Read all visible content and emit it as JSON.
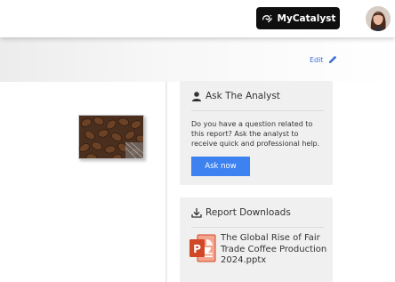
{
  "header": {
    "brand_button_label": "MyCatalyst",
    "brand_icon": "catalyst-swirl-icon",
    "avatar_icon": "user-avatar"
  },
  "toolbar": {
    "edit_label": "Edit",
    "edit_icon": "pencil-icon"
  },
  "report": {
    "thumbnail_icon": "coffee-beans-image"
  },
  "ask_analyst": {
    "title": "Ask The Analyst",
    "icon": "person-icon",
    "description": "Do you have a question related to this report? Ask the analyst to receive quick and professional help.",
    "button_label": "Ask now"
  },
  "downloads": {
    "title": "Report Downloads",
    "icon": "download-icon",
    "file_icon": "powerpoint-icon",
    "file_name": "The Global Rise of Fair Trade Coffee Production 2024.pptx"
  },
  "colors": {
    "brand_button_bg": "#0f0f0f",
    "accent_blue": "#3d82f0",
    "link_blue": "#3a6fd8",
    "card_bg": "#f0f0f0",
    "powerpoint_orange": "#d24726"
  }
}
